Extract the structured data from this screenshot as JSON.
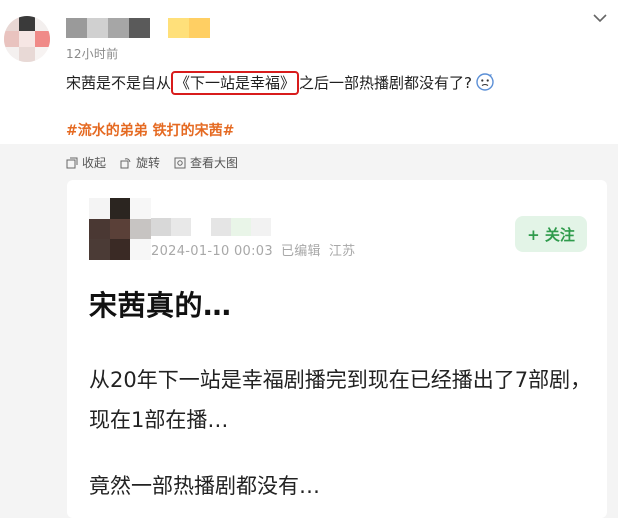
{
  "post": {
    "timestamp": "12小时前",
    "text_before": "宋茜是不是自从",
    "text_highlight": "《下一站是幸福》",
    "text_after": "之后一部热播剧都没有了?",
    "hashtags": "#流水的弟弟 铁打的宋茜#",
    "avatar_colors": [
      "#e8d7d4",
      "#3a3a3a",
      "#f3efee",
      "#e9c3bf",
      "#f6e6e4",
      "#f08a88",
      "#f4f0ef",
      "#e8d9d6",
      "#f7f3f2"
    ],
    "username_colors": [
      "#9a9a9a",
      "#d0d0d0",
      "#a6a6a6",
      "#5a5a5a"
    ],
    "badge_colors": [
      "#ffe07a",
      "#ffcf63"
    ],
    "emoji_icon": "confused-face-icon",
    "chevron_icon": "chevron-down-icon"
  },
  "actions": {
    "collapse_label": "收起",
    "forward_label": "旋转",
    "view_image_label": "查看大图"
  },
  "card": {
    "avatar_colors": [
      "#f4f4f4",
      "#2b2520",
      "#f7f7f7",
      "#4a3833",
      "#5a4038",
      "#c7c4c2",
      "#4b3b36",
      "#3a2a25",
      "#f7f7f7"
    ],
    "username_colors": [
      "#d8d8d8",
      "#e8e8e8",
      "#ffffff",
      "#e5e5e5",
      "#e9f5e8",
      "#f2f2f2"
    ],
    "date": "2024-01-10 00:03",
    "edited": "已编辑",
    "location": "江苏",
    "follow_label": "+ 关注",
    "title": "宋茜真的…",
    "body_line1": "从20年下一站是幸福剧播完到现在已经播出了7部剧，现在1部在播…",
    "body_line2": "竟然一部热播剧都没有…"
  }
}
